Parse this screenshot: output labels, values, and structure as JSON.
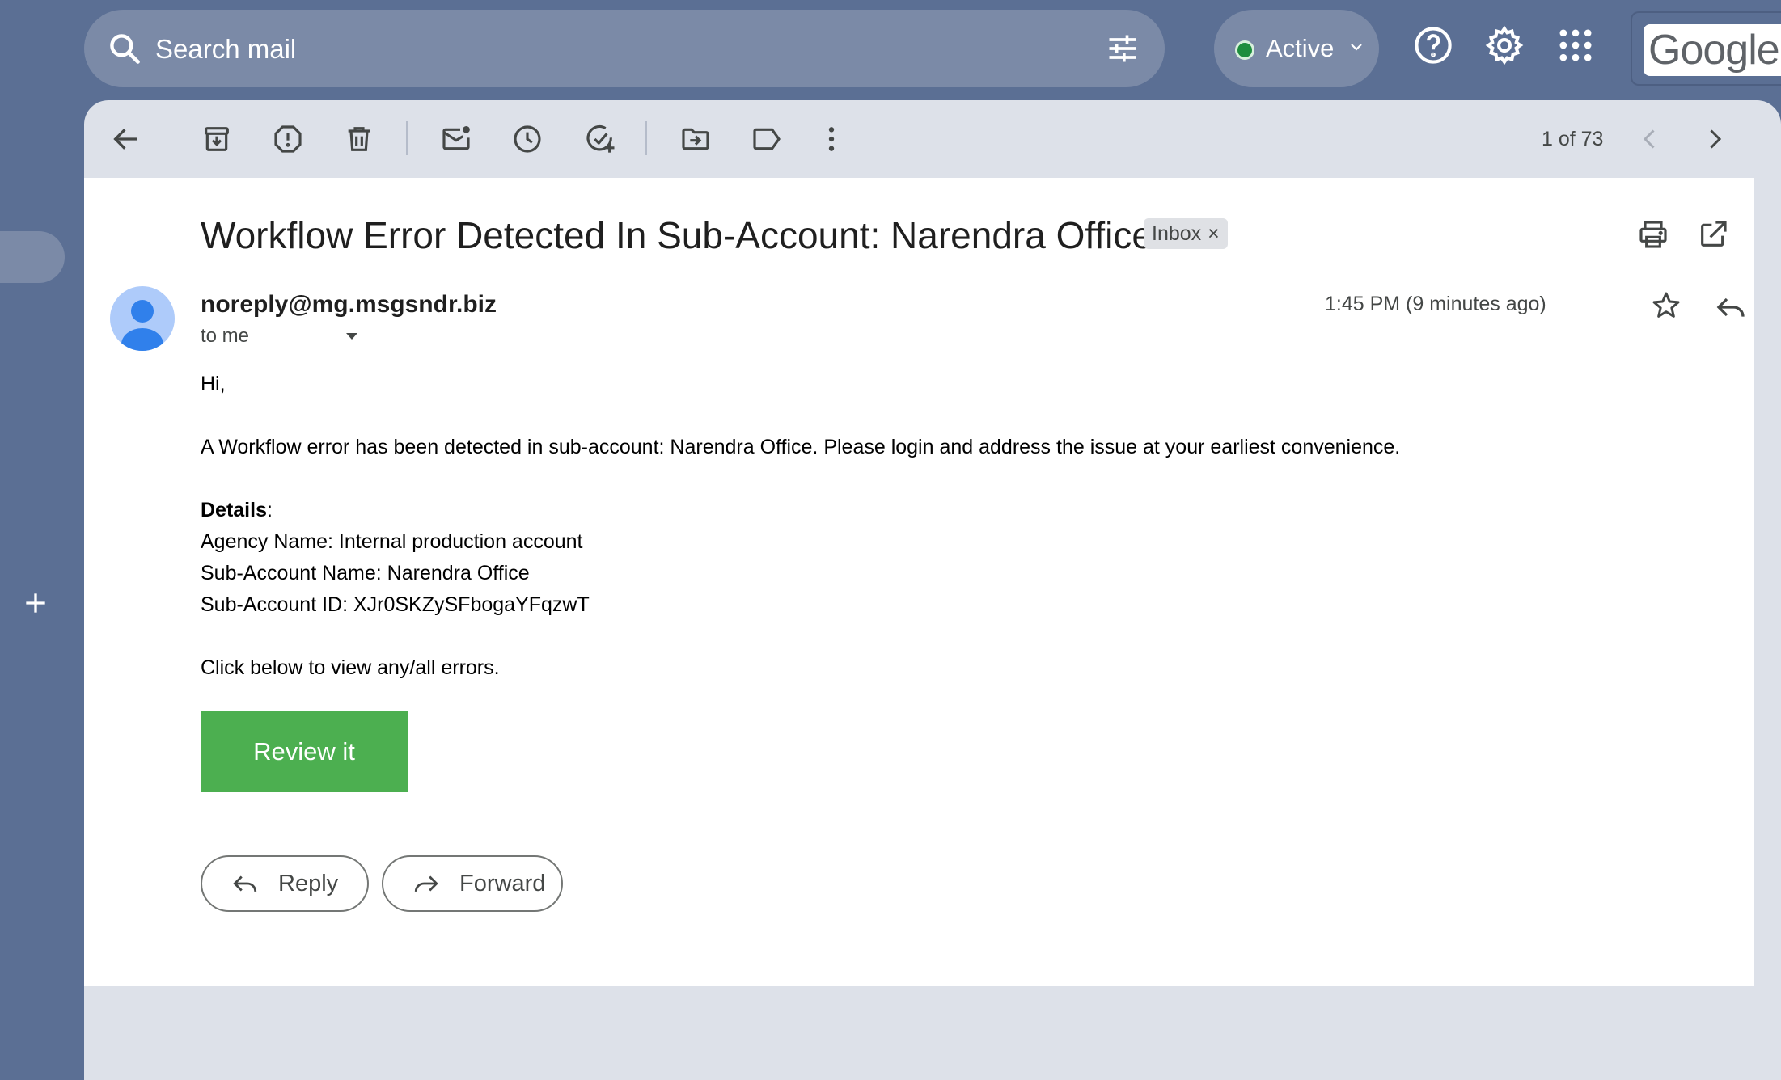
{
  "search": {
    "placeholder": "Search mail"
  },
  "status": {
    "label": "Active",
    "color": "#1e8e3e"
  },
  "header": {
    "logo_text": "Google"
  },
  "toolbar": {
    "page_count": "1 of 73"
  },
  "message": {
    "subject": "Workflow Error Detected In Sub-Account: Narendra Office",
    "label_chip": "Inbox",
    "label_chip_close": "×",
    "sender": "noreply@mg.msgsndr.biz",
    "recipient": "to me",
    "timestamp": "1:45 PM (9 minutes ago)",
    "body": {
      "greeting": "Hi,",
      "intro": "A Workflow error has been detected in sub-account: Narendra Office. Please login and address the issue at your earliest convenience.",
      "details_heading": "Details",
      "details_colon": ":",
      "agency_name": "Agency Name: Internal production account",
      "subaccount_name": "Sub-Account Name: Narendra Office",
      "subaccount_id": "Sub-Account ID: XJr0SKZySFbogaYFqzwT",
      "cta_text": "Click below to view any/all errors.",
      "cta_button": "Review it",
      "cta_button_color": "#4caf50"
    }
  },
  "actions": {
    "reply": "Reply",
    "forward": "Forward"
  },
  "icons": [
    "search-icon",
    "filter-icon",
    "chevron-down-icon",
    "help-icon",
    "settings-icon",
    "apps-icon",
    "plus-icon",
    "back-arrow-icon",
    "archive-icon",
    "report-spam-icon",
    "delete-icon",
    "mark-unread-icon",
    "snooze-icon",
    "add-task-icon",
    "move-to-icon",
    "label-icon",
    "more-vert-icon",
    "chevron-left-icon",
    "chevron-right-icon",
    "print-icon",
    "open-in-new-icon",
    "star-icon",
    "reply-icon",
    "forward-icon"
  ]
}
